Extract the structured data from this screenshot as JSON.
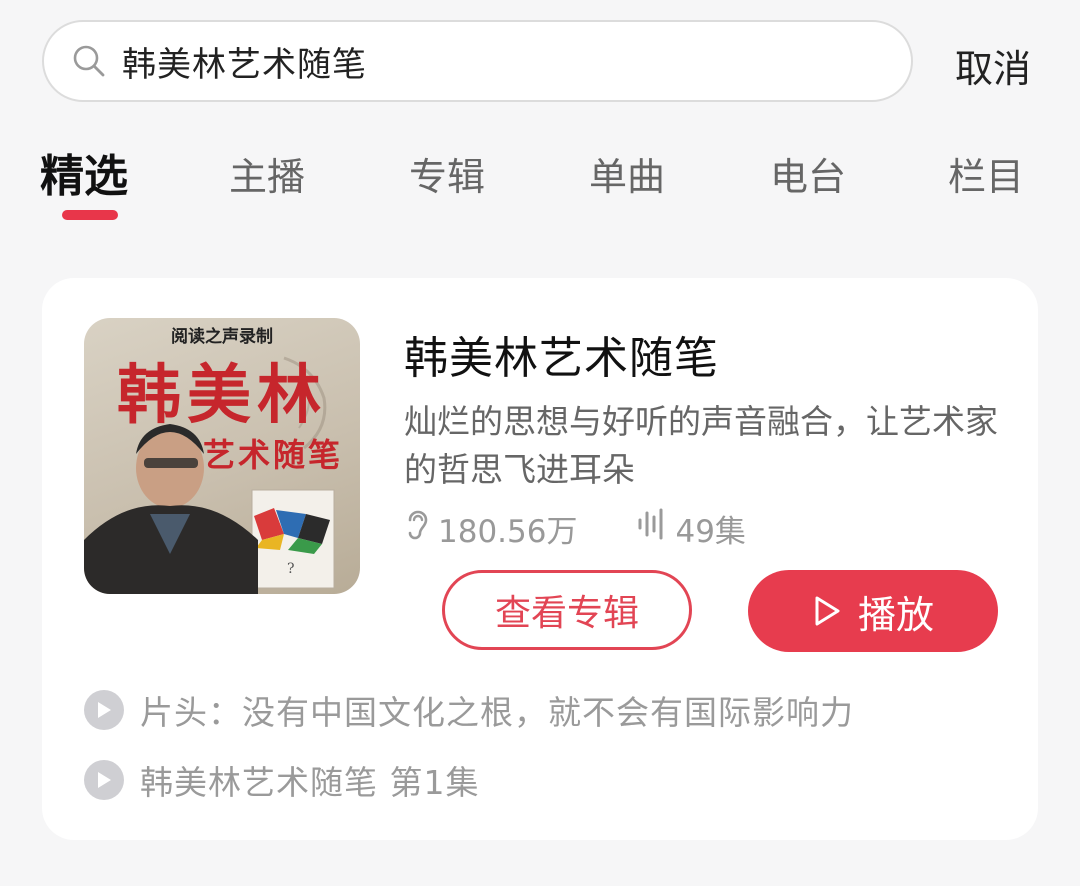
{
  "search": {
    "query": "韩美林艺术随笔",
    "cancel_label": "取消"
  },
  "tabs": [
    {
      "label": "精选",
      "active": true
    },
    {
      "label": "主播",
      "active": false
    },
    {
      "label": "专辑",
      "active": false
    },
    {
      "label": "单曲",
      "active": false
    },
    {
      "label": "电台",
      "active": false
    },
    {
      "label": "栏目",
      "active": false
    }
  ],
  "album": {
    "cover": {
      "badge": "阅读之声录制",
      "title": "韩美林",
      "subtitle": "艺术随笔"
    },
    "title": "韩美林艺术随笔",
    "description": "灿烂的思想与好听的声音融合，让艺术家的哲思飞进耳朵",
    "plays": "180.56万",
    "episodes": "49集",
    "view_button": "查看专辑",
    "play_button": "播放"
  },
  "tracks": [
    {
      "label": "片头：没有中国文化之根，就不会有国际影响力"
    },
    {
      "label": "韩美林艺术随笔 第1集"
    }
  ],
  "colors": {
    "accent": "#e73c4e",
    "tab_indicator": "#e8364a"
  }
}
